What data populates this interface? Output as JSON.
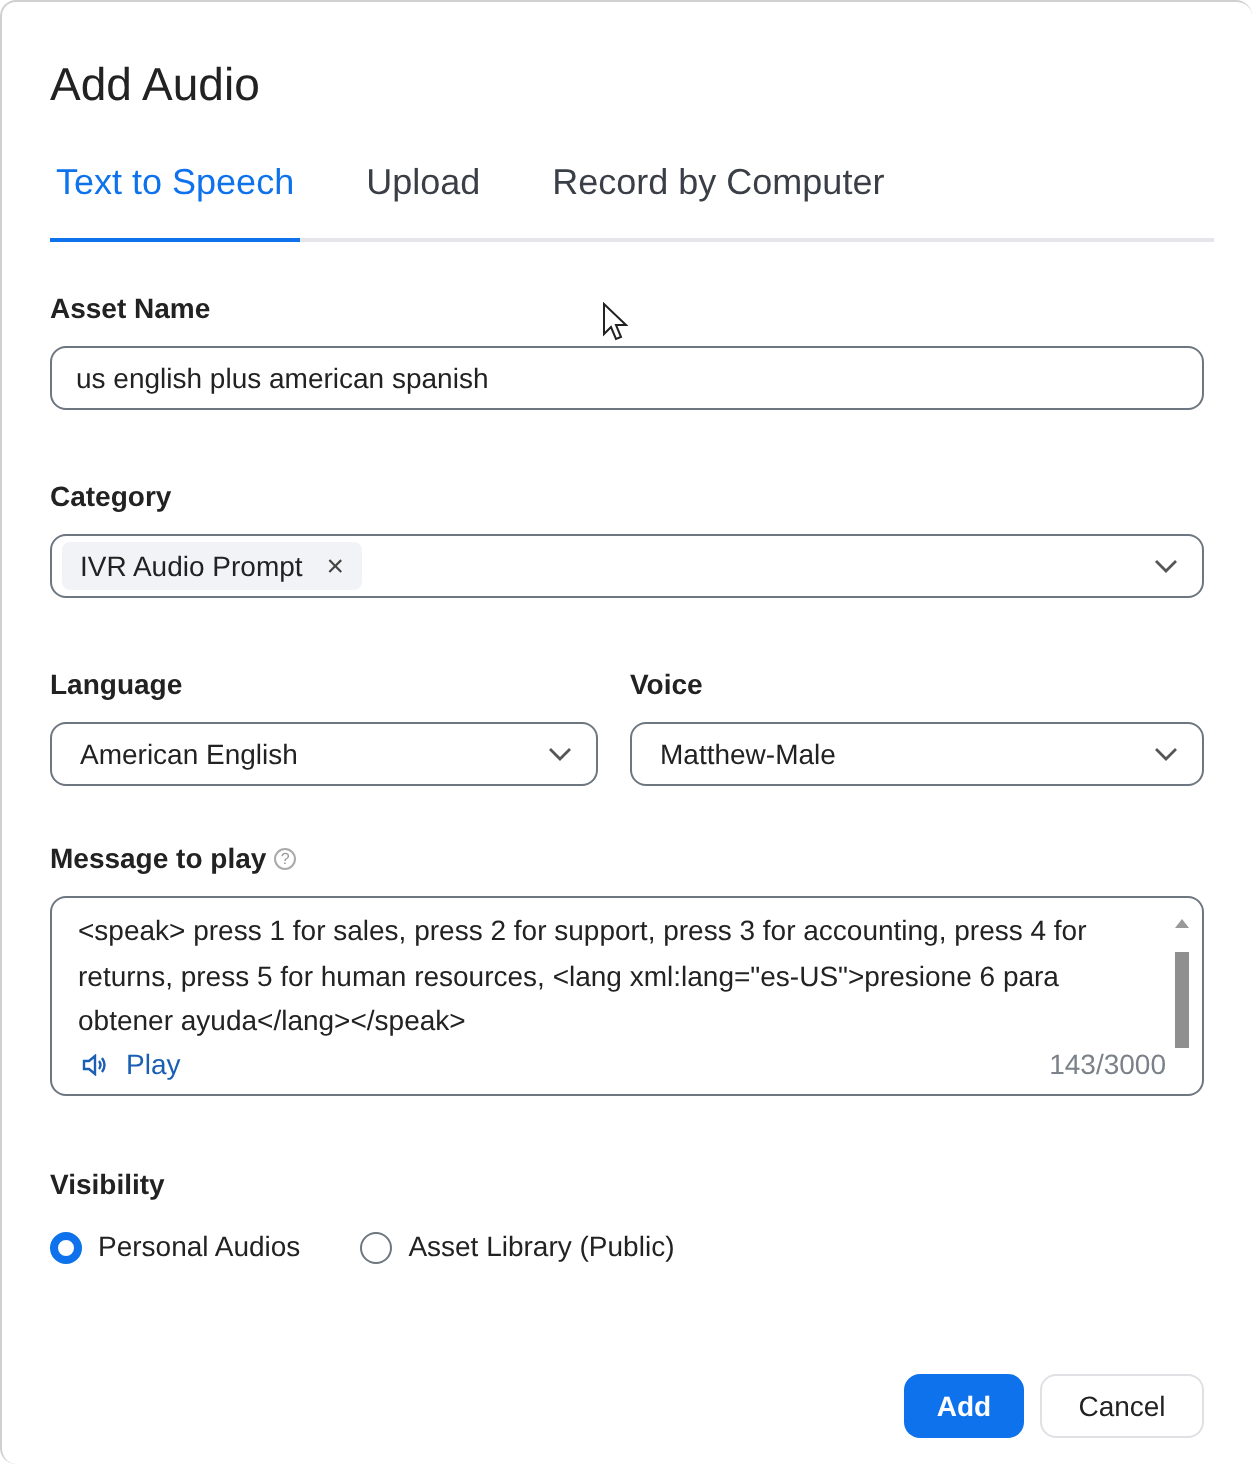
{
  "title": "Add Audio",
  "tabs": [
    {
      "label": "Text to Speech",
      "selected": true
    },
    {
      "label": "Upload",
      "selected": false
    },
    {
      "label": "Record by Computer",
      "selected": false
    }
  ],
  "asset_name": {
    "label": "Asset Name",
    "value": "us english plus american spanish"
  },
  "category": {
    "label": "Category",
    "tags": [
      "IVR Audio Prompt"
    ],
    "remove_mark": "×"
  },
  "language": {
    "label": "Language",
    "value": "American English"
  },
  "voice": {
    "label": "Voice",
    "value": "Matthew-Male"
  },
  "message": {
    "label": "Message to play",
    "help": "?",
    "value": "<speak> press 1 for sales, press 2 for support, press 3 for accounting, press 4 for returns, press 5 for human resources, <lang xml:lang=\"es-US\">presione 6 para obtener ayuda</lang></speak>",
    "play": "Play",
    "count": "143/3000"
  },
  "visibility": {
    "label": "Visibility",
    "options": [
      {
        "label": "Personal Audios",
        "selected": true
      },
      {
        "label": "Asset Library (Public)",
        "selected": false
      }
    ]
  },
  "buttons": [
    {
      "label": "Add",
      "kind": "primary"
    },
    {
      "label": "Cancel",
      "kind": "secondary"
    }
  ]
}
